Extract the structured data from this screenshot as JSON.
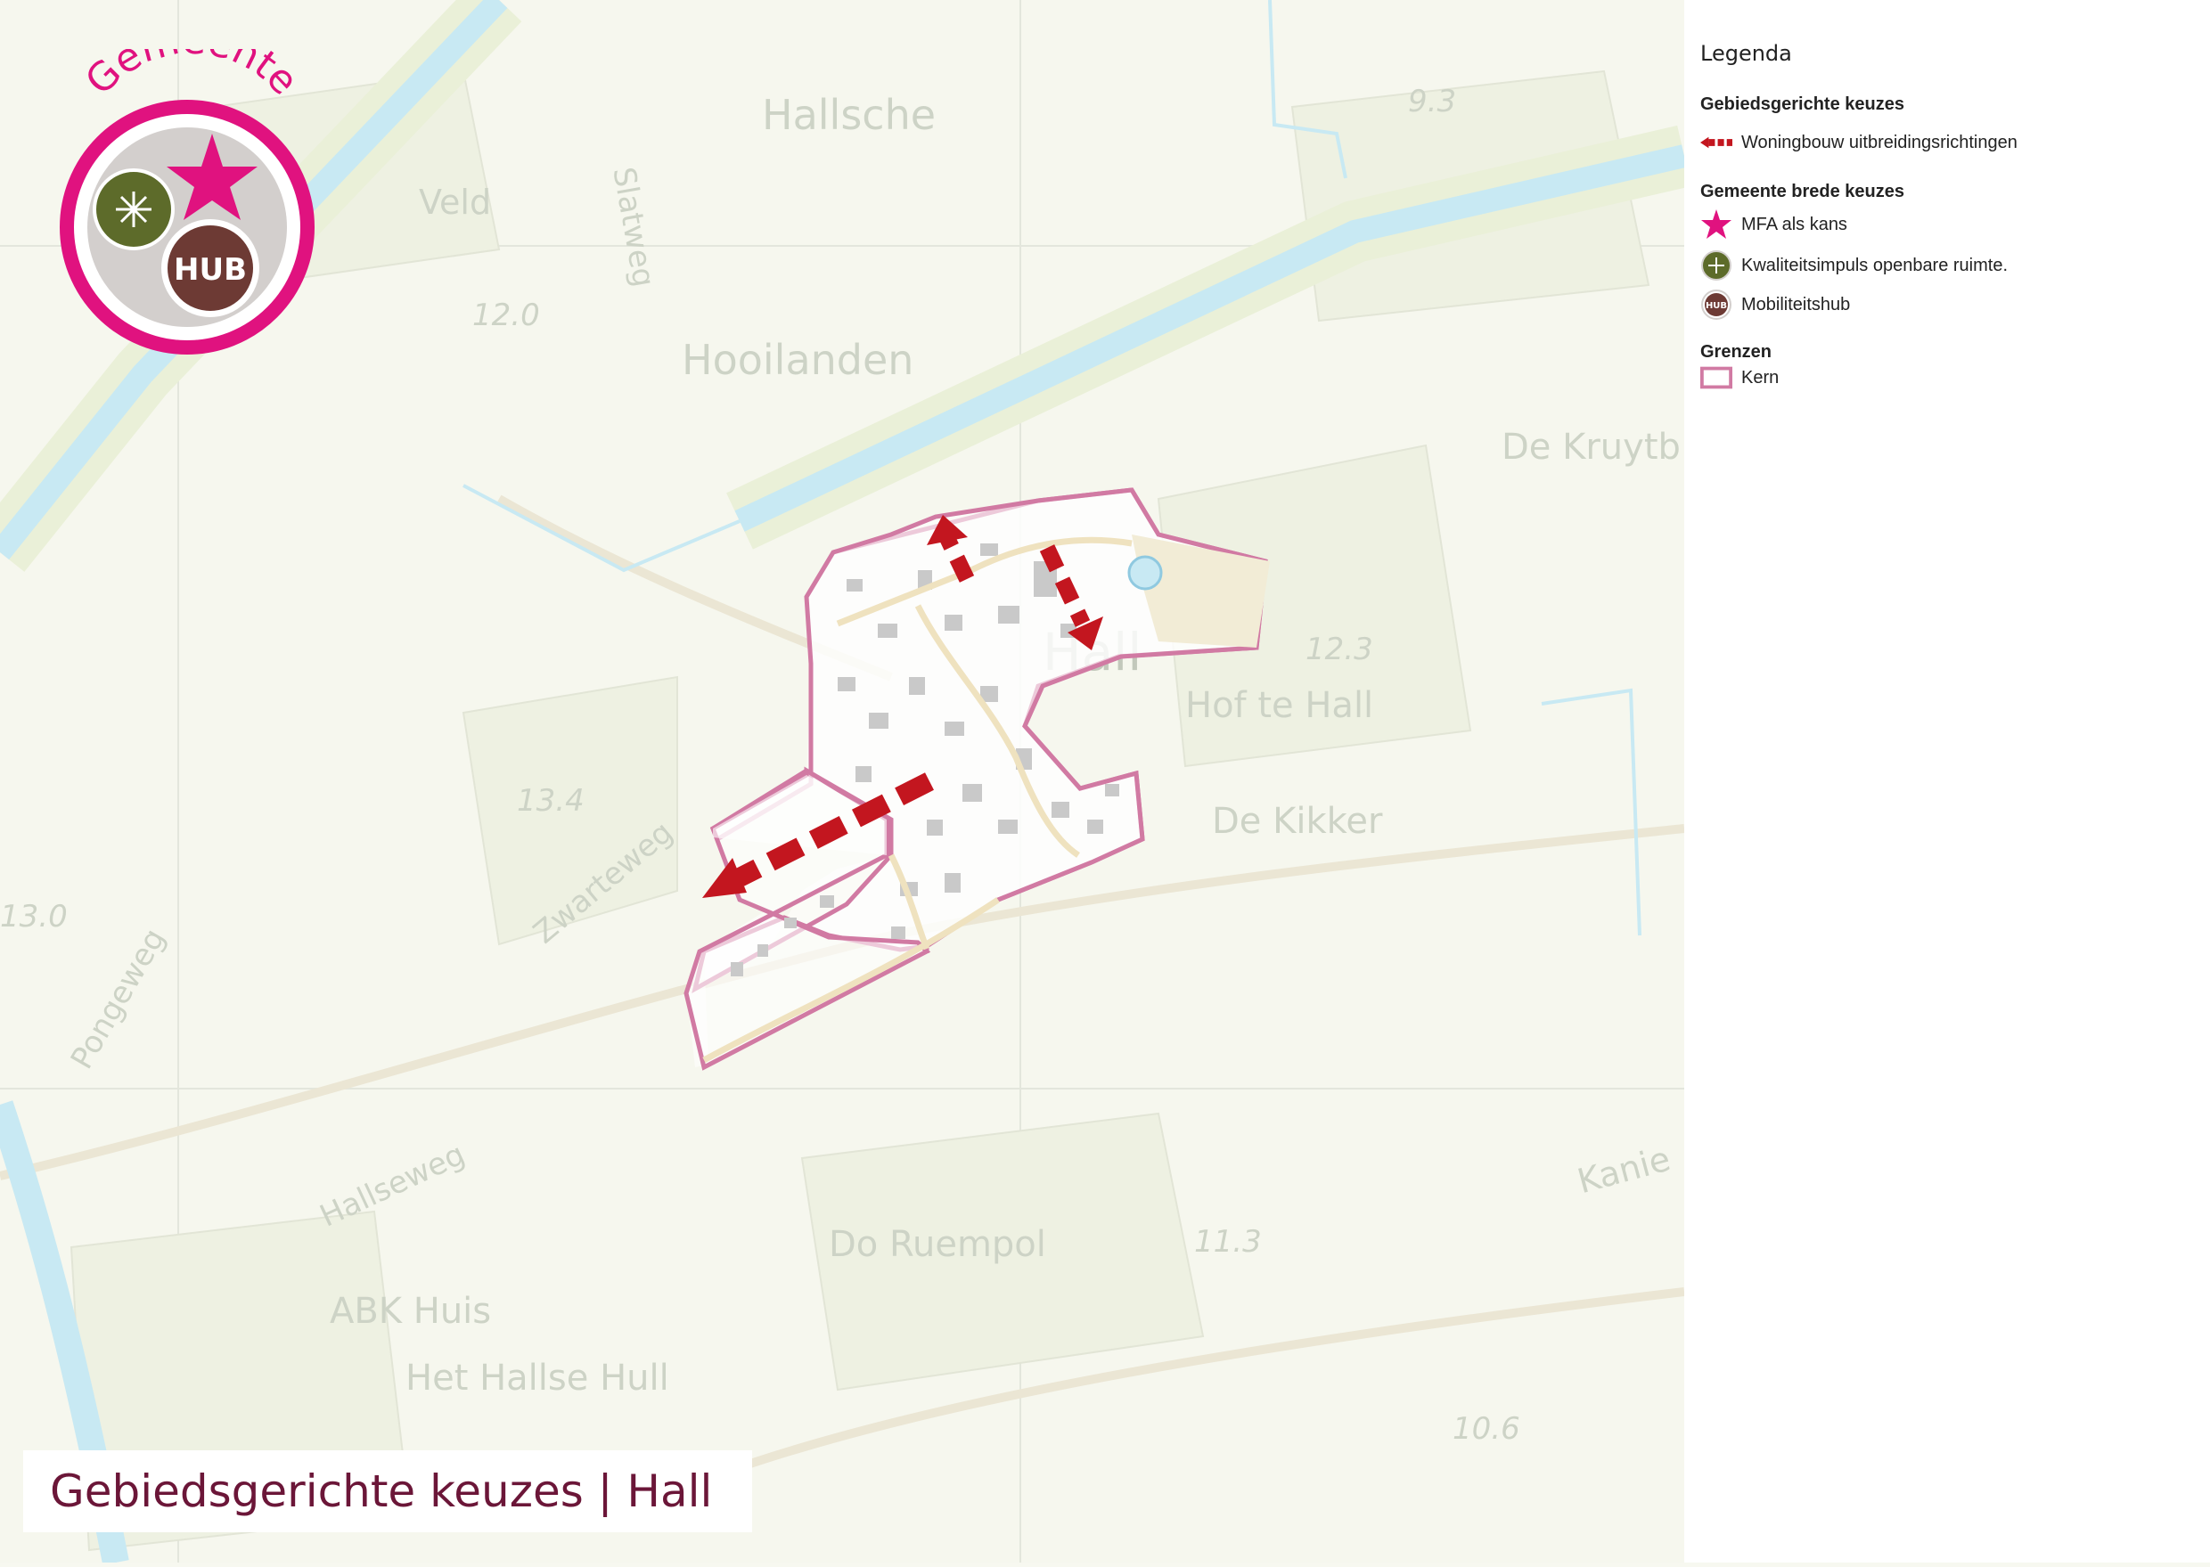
{
  "map": {
    "place_labels": [
      "Hallsche",
      "Hooilanden",
      "Veld",
      "Hall",
      "Hof te Hall",
      "De Kikker",
      "De Kruytb",
      "Do Ruempol",
      "ABK Huis",
      "Het Hallse Hull",
      "Kanie"
    ],
    "road_labels": [
      "Slatweg",
      "Zwarteweg",
      "Hallseweg",
      "Pongeweg"
    ],
    "elevation_labels": [
      "12.0",
      "12.3",
      "13.4",
      "13.0",
      "11.3",
      "10.6",
      "9.3"
    ],
    "badge": {
      "arc_text": "Gemeente",
      "hub_text": "HUB"
    },
    "colors": {
      "kern_border": "#d17aa3",
      "arrow": "#c3161f",
      "star": "#e0127f",
      "quality": "#5d6b2a",
      "hub": "#6d3a34",
      "water": "#c8e9f3"
    }
  },
  "legend": {
    "title": "Legenda",
    "section_area": "Gebiedsgerichte keuzes",
    "item_housing": "Woningbouw uitbreidingsrichtingen",
    "section_municipal": "Gemeente brede keuzes",
    "item_mfa": "MFA als kans",
    "item_quality": "Kwaliteitsimpuls openbare ruimte.",
    "item_hub": "Mobiliteitshub",
    "section_borders": "Grenzen",
    "item_kern": "Kern"
  },
  "title": "Gebiedsgerichte keuzes | Hall"
}
